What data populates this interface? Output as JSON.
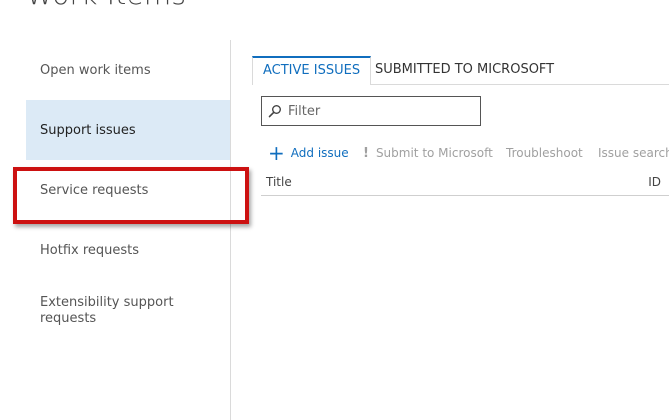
{
  "page": {
    "title": "Work Items"
  },
  "sidebar": {
    "items": [
      {
        "label": "Open work items"
      },
      {
        "label": "Support issues"
      },
      {
        "label": "Service requests"
      },
      {
        "label": "Hotfix requests"
      },
      {
        "label": "Extensibility support requests"
      }
    ],
    "selected": "Support issues"
  },
  "tabs": [
    {
      "label": "ACTIVE ISSUES"
    },
    {
      "label": "SUBMITTED TO MICROSOFT"
    }
  ],
  "filter": {
    "placeholder": "Filter"
  },
  "toolbar": {
    "add_issue": "Add issue",
    "submit": "Submit to Microsoft",
    "troubleshoot": "Troubleshoot",
    "issue_search": "Issue search"
  },
  "grid": {
    "columns": [
      {
        "label": "Title"
      },
      {
        "label": "ID"
      }
    ]
  },
  "colors": {
    "accent": "#106ebe",
    "selected_bg": "#dceaf6",
    "highlight_border": "#cc1111",
    "disabled_text": "#a0a0a0"
  }
}
